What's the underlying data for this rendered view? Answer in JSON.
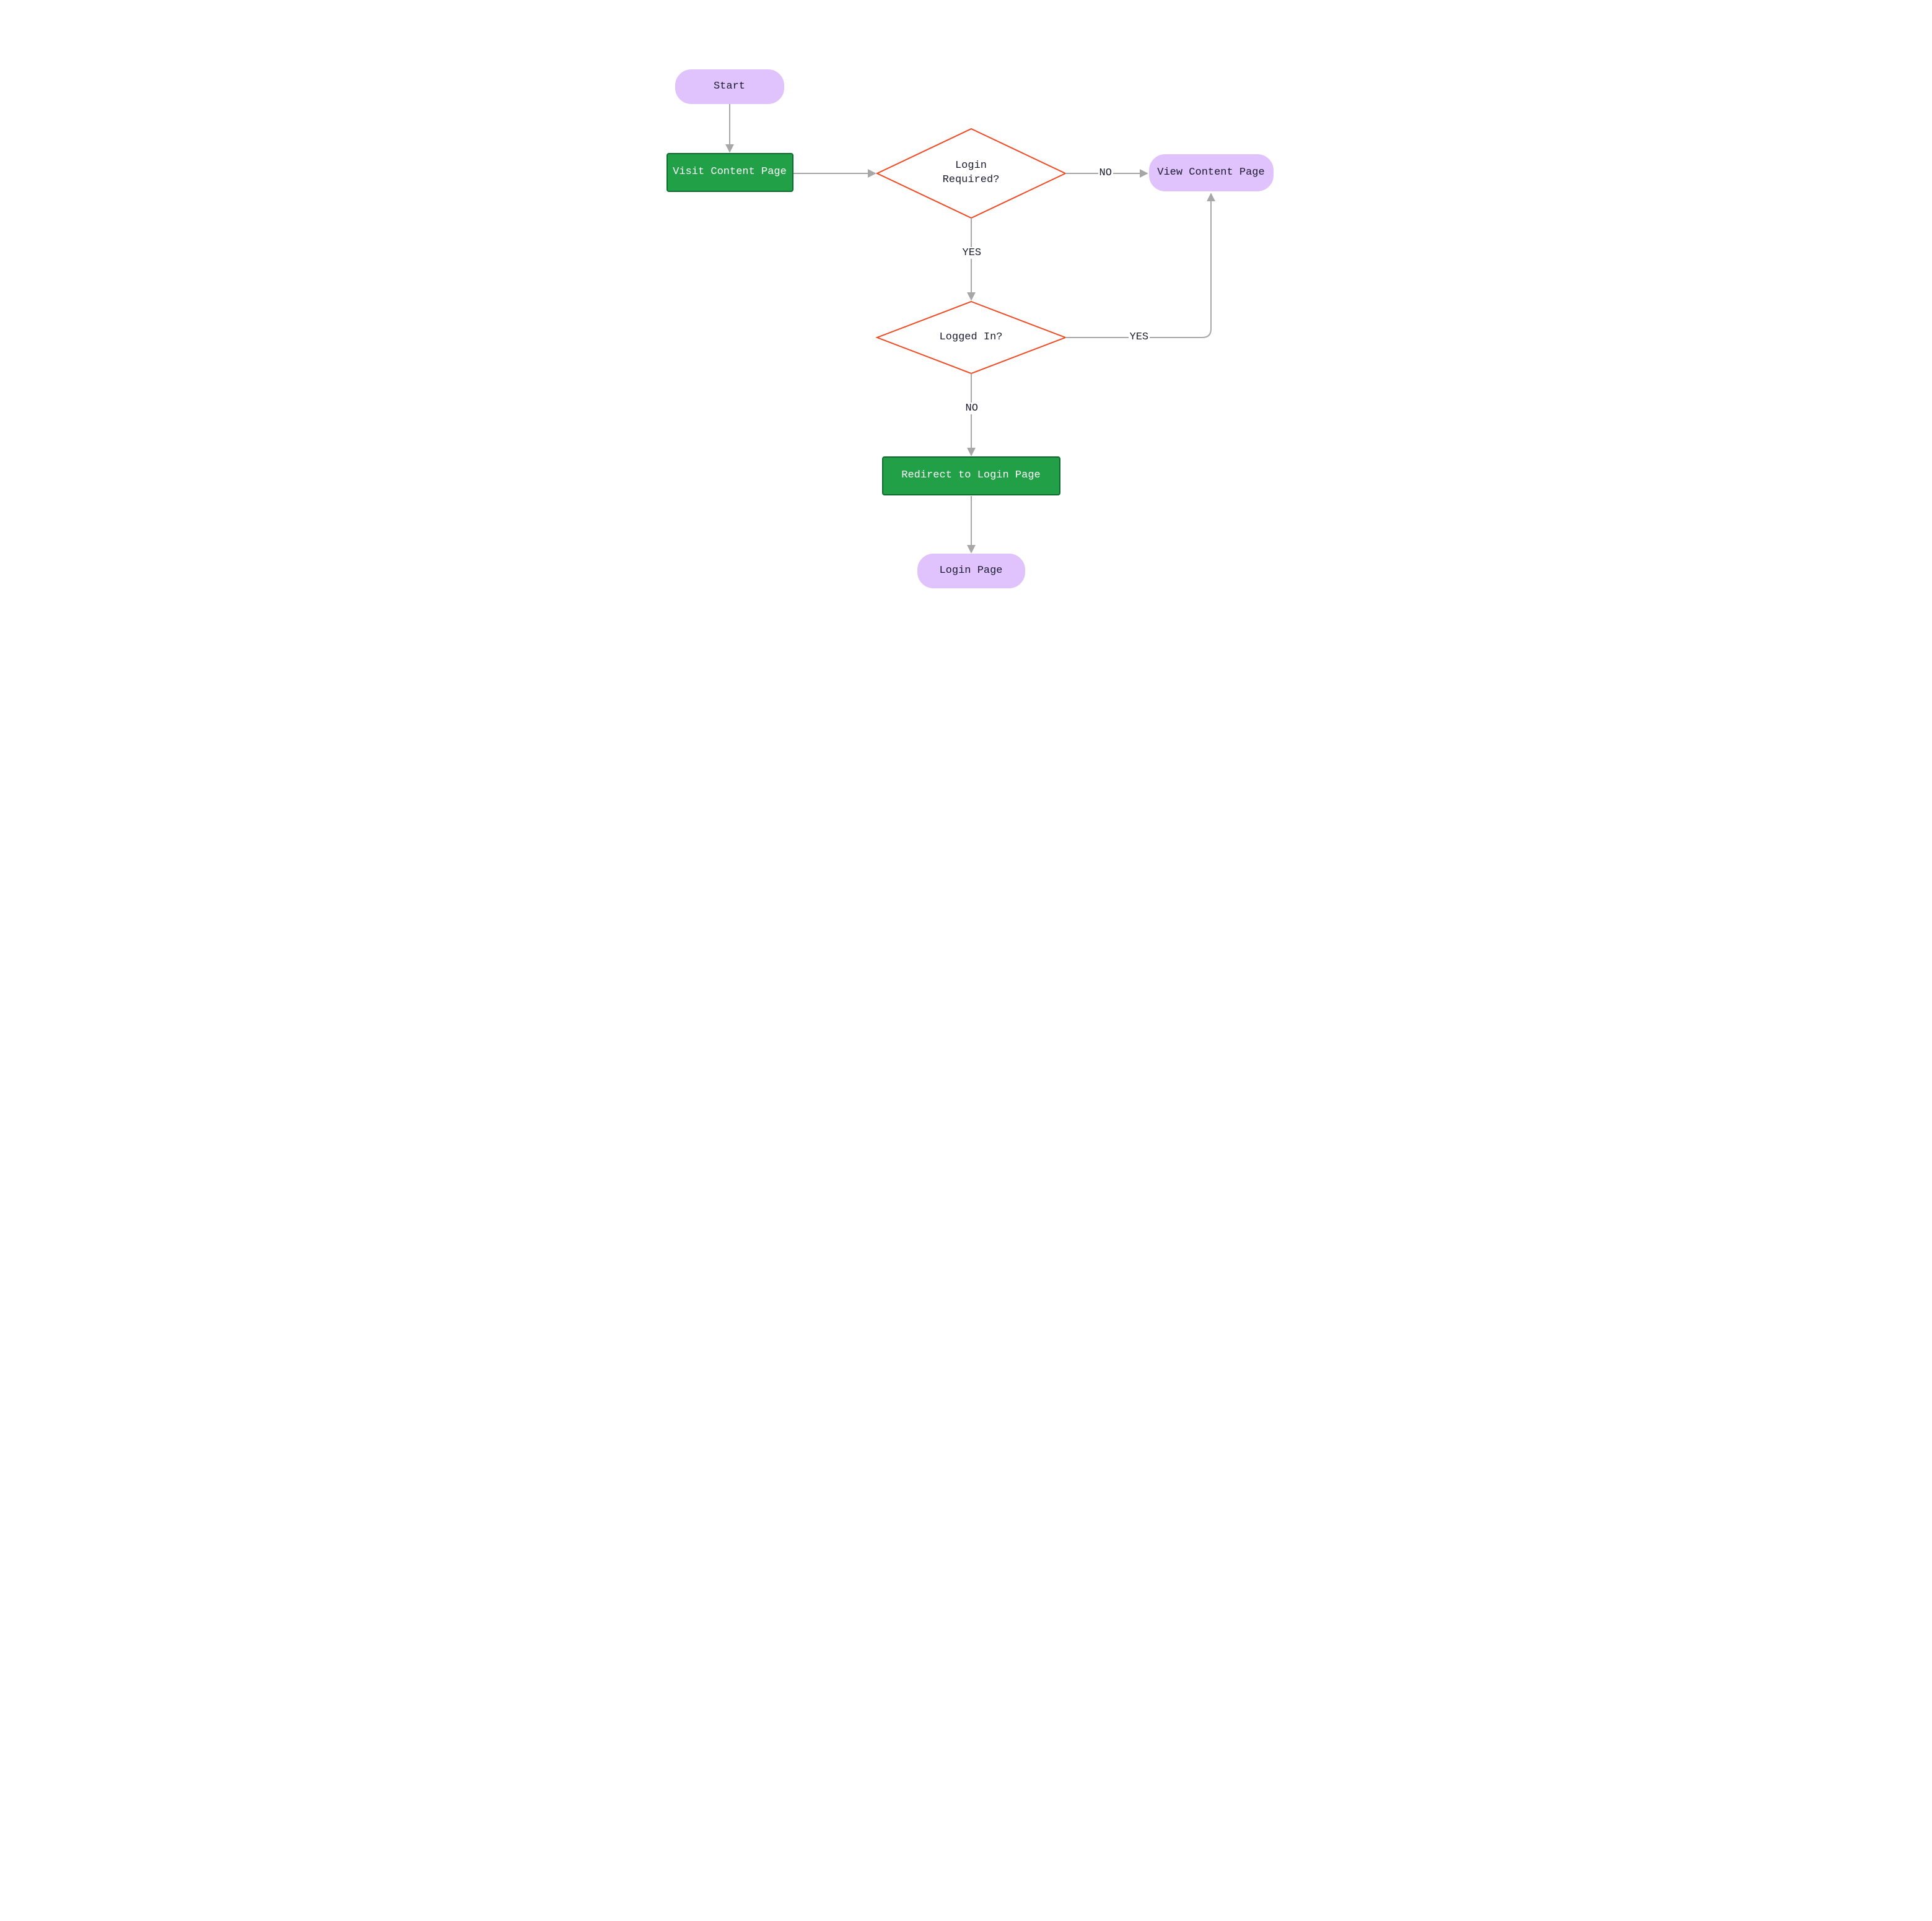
{
  "colors": {
    "terminal_fill": "#e0c3fc",
    "process_fill": "#22a047",
    "process_border": "#0f6a2e",
    "decision_border": "#f24822",
    "arrow": "#a7a7a7",
    "text_dark": "#1b1b2f",
    "text_light": "#ffffff"
  },
  "nodes": {
    "start": {
      "label": "Start"
    },
    "visit": {
      "label": "Visit Content Page"
    },
    "decide1": {
      "label": "Login\nRequired?"
    },
    "view": {
      "label": "View Content Page"
    },
    "decide2": {
      "label": "Logged In?"
    },
    "redirect": {
      "label": "Redirect to Login Page"
    },
    "loginpg": {
      "label": "Login Page"
    }
  },
  "edges": {
    "d1_no": {
      "label": "NO"
    },
    "d1_yes": {
      "label": "YES"
    },
    "d2_yes": {
      "label": "YES"
    },
    "d2_no": {
      "label": "NO"
    }
  }
}
